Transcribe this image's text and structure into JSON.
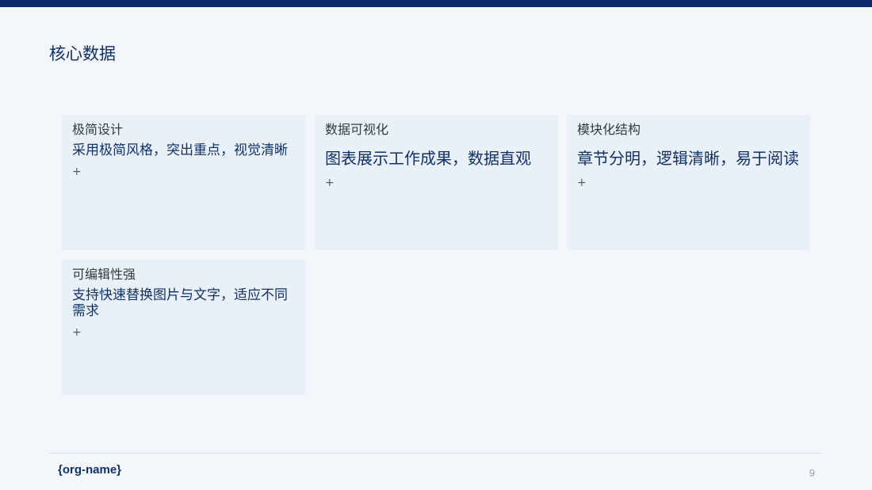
{
  "slide": {
    "title": "核心数据",
    "page_number": "9"
  },
  "cards": [
    {
      "title": "极简设计",
      "description": "采用极简风格，突出重点，视觉清晰",
      "plus": "+"
    },
    {
      "title": "数据可视化",
      "description": "图表展示工作成果，数据直观",
      "plus": "+"
    },
    {
      "title": "模块化结构",
      "description": "章节分明，逻辑清晰，易于阅读",
      "plus": "+"
    },
    {
      "title": "可编辑性强",
      "description": "支持快速替换图片与文字，适应不同需求",
      "plus": "+"
    }
  ],
  "footer": {
    "org_name": "{org-name}"
  },
  "colors": {
    "accent": "#0e2a6b",
    "heading": "#10306e",
    "background": "#f3f7fb",
    "card_background": "#eaf0f7"
  }
}
